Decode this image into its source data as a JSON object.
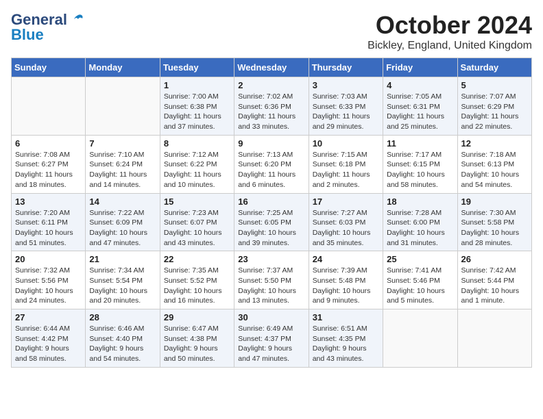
{
  "logo": {
    "text1": "General",
    "text2": "Blue"
  },
  "title": "October 2024",
  "location": "Bickley, England, United Kingdom",
  "weekdays": [
    "Sunday",
    "Monday",
    "Tuesday",
    "Wednesday",
    "Thursday",
    "Friday",
    "Saturday"
  ],
  "weeks": [
    [
      {
        "day": "",
        "info": ""
      },
      {
        "day": "",
        "info": ""
      },
      {
        "day": "1",
        "info": "Sunrise: 7:00 AM\nSunset: 6:38 PM\nDaylight: 11 hours\nand 37 minutes."
      },
      {
        "day": "2",
        "info": "Sunrise: 7:02 AM\nSunset: 6:36 PM\nDaylight: 11 hours\nand 33 minutes."
      },
      {
        "day": "3",
        "info": "Sunrise: 7:03 AM\nSunset: 6:33 PM\nDaylight: 11 hours\nand 29 minutes."
      },
      {
        "day": "4",
        "info": "Sunrise: 7:05 AM\nSunset: 6:31 PM\nDaylight: 11 hours\nand 25 minutes."
      },
      {
        "day": "5",
        "info": "Sunrise: 7:07 AM\nSunset: 6:29 PM\nDaylight: 11 hours\nand 22 minutes."
      }
    ],
    [
      {
        "day": "6",
        "info": "Sunrise: 7:08 AM\nSunset: 6:27 PM\nDaylight: 11 hours\nand 18 minutes."
      },
      {
        "day": "7",
        "info": "Sunrise: 7:10 AM\nSunset: 6:24 PM\nDaylight: 11 hours\nand 14 minutes."
      },
      {
        "day": "8",
        "info": "Sunrise: 7:12 AM\nSunset: 6:22 PM\nDaylight: 11 hours\nand 10 minutes."
      },
      {
        "day": "9",
        "info": "Sunrise: 7:13 AM\nSunset: 6:20 PM\nDaylight: 11 hours\nand 6 minutes."
      },
      {
        "day": "10",
        "info": "Sunrise: 7:15 AM\nSunset: 6:18 PM\nDaylight: 11 hours\nand 2 minutes."
      },
      {
        "day": "11",
        "info": "Sunrise: 7:17 AM\nSunset: 6:15 PM\nDaylight: 10 hours\nand 58 minutes."
      },
      {
        "day": "12",
        "info": "Sunrise: 7:18 AM\nSunset: 6:13 PM\nDaylight: 10 hours\nand 54 minutes."
      }
    ],
    [
      {
        "day": "13",
        "info": "Sunrise: 7:20 AM\nSunset: 6:11 PM\nDaylight: 10 hours\nand 51 minutes."
      },
      {
        "day": "14",
        "info": "Sunrise: 7:22 AM\nSunset: 6:09 PM\nDaylight: 10 hours\nand 47 minutes."
      },
      {
        "day": "15",
        "info": "Sunrise: 7:23 AM\nSunset: 6:07 PM\nDaylight: 10 hours\nand 43 minutes."
      },
      {
        "day": "16",
        "info": "Sunrise: 7:25 AM\nSunset: 6:05 PM\nDaylight: 10 hours\nand 39 minutes."
      },
      {
        "day": "17",
        "info": "Sunrise: 7:27 AM\nSunset: 6:03 PM\nDaylight: 10 hours\nand 35 minutes."
      },
      {
        "day": "18",
        "info": "Sunrise: 7:28 AM\nSunset: 6:00 PM\nDaylight: 10 hours\nand 31 minutes."
      },
      {
        "day": "19",
        "info": "Sunrise: 7:30 AM\nSunset: 5:58 PM\nDaylight: 10 hours\nand 28 minutes."
      }
    ],
    [
      {
        "day": "20",
        "info": "Sunrise: 7:32 AM\nSunset: 5:56 PM\nDaylight: 10 hours\nand 24 minutes."
      },
      {
        "day": "21",
        "info": "Sunrise: 7:34 AM\nSunset: 5:54 PM\nDaylight: 10 hours\nand 20 minutes."
      },
      {
        "day": "22",
        "info": "Sunrise: 7:35 AM\nSunset: 5:52 PM\nDaylight: 10 hours\nand 16 minutes."
      },
      {
        "day": "23",
        "info": "Sunrise: 7:37 AM\nSunset: 5:50 PM\nDaylight: 10 hours\nand 13 minutes."
      },
      {
        "day": "24",
        "info": "Sunrise: 7:39 AM\nSunset: 5:48 PM\nDaylight: 10 hours\nand 9 minutes."
      },
      {
        "day": "25",
        "info": "Sunrise: 7:41 AM\nSunset: 5:46 PM\nDaylight: 10 hours\nand 5 minutes."
      },
      {
        "day": "26",
        "info": "Sunrise: 7:42 AM\nSunset: 5:44 PM\nDaylight: 10 hours\nand 1 minute."
      }
    ],
    [
      {
        "day": "27",
        "info": "Sunrise: 6:44 AM\nSunset: 4:42 PM\nDaylight: 9 hours\nand 58 minutes."
      },
      {
        "day": "28",
        "info": "Sunrise: 6:46 AM\nSunset: 4:40 PM\nDaylight: 9 hours\nand 54 minutes."
      },
      {
        "day": "29",
        "info": "Sunrise: 6:47 AM\nSunset: 4:38 PM\nDaylight: 9 hours\nand 50 minutes."
      },
      {
        "day": "30",
        "info": "Sunrise: 6:49 AM\nSunset: 4:37 PM\nDaylight: 9 hours\nand 47 minutes."
      },
      {
        "day": "31",
        "info": "Sunrise: 6:51 AM\nSunset: 4:35 PM\nDaylight: 9 hours\nand 43 minutes."
      },
      {
        "day": "",
        "info": ""
      },
      {
        "day": "",
        "info": ""
      }
    ]
  ]
}
